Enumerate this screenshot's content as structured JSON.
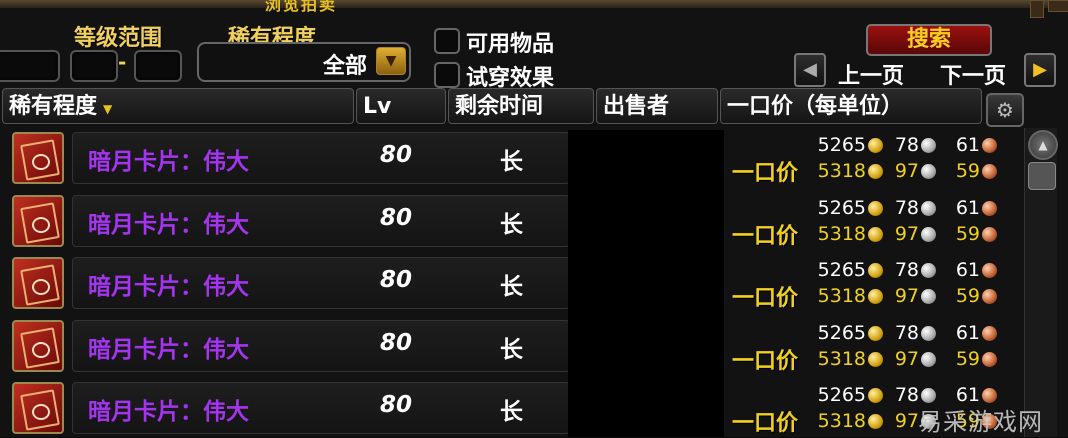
{
  "window": {
    "title": "浏览拍卖"
  },
  "filters": {
    "level_range_label": "等级范围",
    "level_sep": "-",
    "rarity_label": "稀有程度",
    "rarity_value": "全部",
    "usable_label": "可用物品",
    "preview_label": "试穿效果",
    "search_label": "搜索",
    "prev_label": "上一页",
    "next_label": "下一页"
  },
  "columns": {
    "rarity": "稀有程度",
    "lv": "Lv",
    "time_left": "剩余时间",
    "seller": "出售者",
    "buyout": "一口价（每单位）"
  },
  "buyout_label": "一口价",
  "rows": [
    {
      "name": "暗月卡片：伟大",
      "lv": "80",
      "time": "长",
      "bid_g": "5265",
      "bid_s": "78",
      "bid_c": "61",
      "buy_g": "5318",
      "buy_s": "97",
      "buy_c": "59"
    },
    {
      "name": "暗月卡片：伟大",
      "lv": "80",
      "time": "长",
      "bid_g": "5265",
      "bid_s": "78",
      "bid_c": "61",
      "buy_g": "5318",
      "buy_s": "97",
      "buy_c": "59"
    },
    {
      "name": "暗月卡片：伟大",
      "lv": "80",
      "time": "长",
      "bid_g": "5265",
      "bid_s": "78",
      "bid_c": "61",
      "buy_g": "5318",
      "buy_s": "97",
      "buy_c": "59"
    },
    {
      "name": "暗月卡片：伟大",
      "lv": "80",
      "time": "长",
      "bid_g": "5265",
      "bid_s": "78",
      "bid_c": "61",
      "buy_g": "5318",
      "buy_s": "97",
      "buy_c": "59"
    },
    {
      "name": "暗月卡片：伟大",
      "lv": "80",
      "time": "长",
      "bid_g": "5265",
      "bid_s": "78",
      "bid_c": "61",
      "buy_g": "5318",
      "buy_s": "97",
      "buy_c": "59"
    }
  ],
  "watermark": "易采游戏网",
  "colors": {
    "epic": "#a335ee",
    "gold_text": "#f0d020"
  }
}
